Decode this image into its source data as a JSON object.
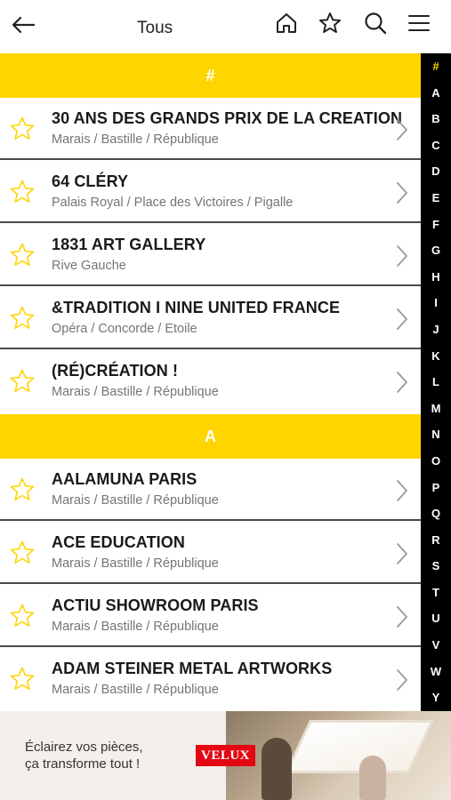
{
  "header": {
    "title": "Tous",
    "icons": [
      "back-arrow-icon",
      "home-icon",
      "star-icon",
      "search-icon",
      "menu-icon"
    ]
  },
  "sections": [
    {
      "label": "#",
      "items": [
        {
          "name": "30 ANS DES GRANDS PRIX DE LA CREATION",
          "area": "Marais / Bastille / République"
        },
        {
          "name": "64 CLÉRY",
          "area": "Palais Royal / Place des Victoires / Pigalle"
        },
        {
          "name": "1831 ART GALLERY",
          "area": "Rive Gauche"
        },
        {
          "name": "&TRADITION I NINE UNITED FRANCE",
          "area": "Opéra / Concorde / Etoile"
        },
        {
          "name": "(RÉ)CRÉATION !",
          "area": "Marais / Bastille / République"
        }
      ]
    },
    {
      "label": "A",
      "items": [
        {
          "name": "AALAMUNA PARIS",
          "area": "Marais / Bastille / République"
        },
        {
          "name": "ACE EDUCATION",
          "area": "Marais / Bastille / République"
        },
        {
          "name": "ACTIU SHOWROOM PARIS",
          "area": "Marais / Bastille / République"
        },
        {
          "name": "ADAM STEINER METAL ARTWORKS",
          "area": "Marais / Bastille / République"
        }
      ]
    }
  ],
  "alphabet": [
    "#",
    "A",
    "B",
    "C",
    "D",
    "E",
    "F",
    "G",
    "H",
    "I",
    "J",
    "K",
    "L",
    "M",
    "N",
    "O",
    "P",
    "Q",
    "R",
    "S",
    "T",
    "U",
    "V",
    "W",
    "Y"
  ],
  "ad": {
    "tagline_line1": "Éclairez vos pièces,",
    "tagline_line2": "ça transforme tout !",
    "brand": "VELUX"
  },
  "colors": {
    "accent": "#FFD500",
    "index_bg": "#000000",
    "divider": "#4a4a4a",
    "subtitle": "#757575"
  }
}
